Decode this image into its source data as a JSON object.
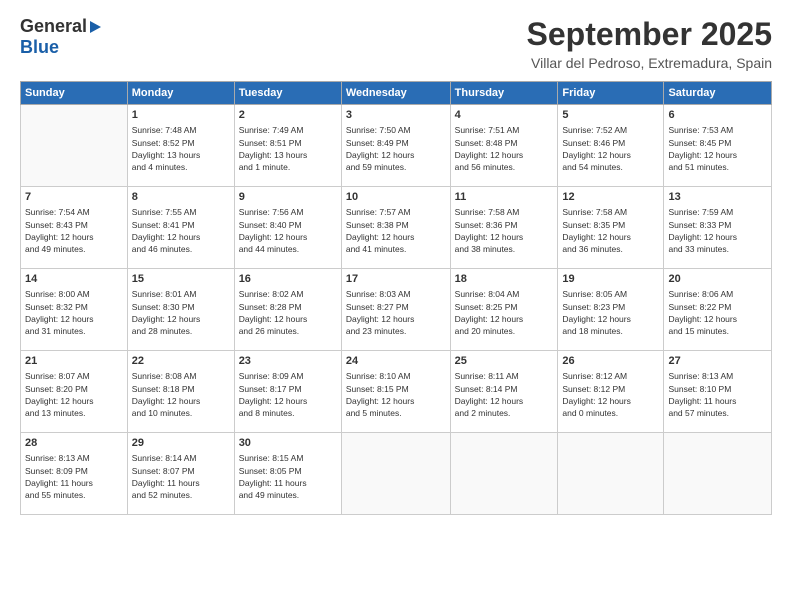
{
  "logo": {
    "line1": "General",
    "arrow": "▶",
    "line2": "Blue"
  },
  "title": "September 2025",
  "location": "Villar del Pedroso, Extremadura, Spain",
  "weekdays": [
    "Sunday",
    "Monday",
    "Tuesday",
    "Wednesday",
    "Thursday",
    "Friday",
    "Saturday"
  ],
  "weeks": [
    [
      {
        "day": "",
        "info": ""
      },
      {
        "day": "1",
        "info": "Sunrise: 7:48 AM\nSunset: 8:52 PM\nDaylight: 13 hours\nand 4 minutes."
      },
      {
        "day": "2",
        "info": "Sunrise: 7:49 AM\nSunset: 8:51 PM\nDaylight: 13 hours\nand 1 minute."
      },
      {
        "day": "3",
        "info": "Sunrise: 7:50 AM\nSunset: 8:49 PM\nDaylight: 12 hours\nand 59 minutes."
      },
      {
        "day": "4",
        "info": "Sunrise: 7:51 AM\nSunset: 8:48 PM\nDaylight: 12 hours\nand 56 minutes."
      },
      {
        "day": "5",
        "info": "Sunrise: 7:52 AM\nSunset: 8:46 PM\nDaylight: 12 hours\nand 54 minutes."
      },
      {
        "day": "6",
        "info": "Sunrise: 7:53 AM\nSunset: 8:45 PM\nDaylight: 12 hours\nand 51 minutes."
      }
    ],
    [
      {
        "day": "7",
        "info": "Sunrise: 7:54 AM\nSunset: 8:43 PM\nDaylight: 12 hours\nand 49 minutes."
      },
      {
        "day": "8",
        "info": "Sunrise: 7:55 AM\nSunset: 8:41 PM\nDaylight: 12 hours\nand 46 minutes."
      },
      {
        "day": "9",
        "info": "Sunrise: 7:56 AM\nSunset: 8:40 PM\nDaylight: 12 hours\nand 44 minutes."
      },
      {
        "day": "10",
        "info": "Sunrise: 7:57 AM\nSunset: 8:38 PM\nDaylight: 12 hours\nand 41 minutes."
      },
      {
        "day": "11",
        "info": "Sunrise: 7:58 AM\nSunset: 8:36 PM\nDaylight: 12 hours\nand 38 minutes."
      },
      {
        "day": "12",
        "info": "Sunrise: 7:58 AM\nSunset: 8:35 PM\nDaylight: 12 hours\nand 36 minutes."
      },
      {
        "day": "13",
        "info": "Sunrise: 7:59 AM\nSunset: 8:33 PM\nDaylight: 12 hours\nand 33 minutes."
      }
    ],
    [
      {
        "day": "14",
        "info": "Sunrise: 8:00 AM\nSunset: 8:32 PM\nDaylight: 12 hours\nand 31 minutes."
      },
      {
        "day": "15",
        "info": "Sunrise: 8:01 AM\nSunset: 8:30 PM\nDaylight: 12 hours\nand 28 minutes."
      },
      {
        "day": "16",
        "info": "Sunrise: 8:02 AM\nSunset: 8:28 PM\nDaylight: 12 hours\nand 26 minutes."
      },
      {
        "day": "17",
        "info": "Sunrise: 8:03 AM\nSunset: 8:27 PM\nDaylight: 12 hours\nand 23 minutes."
      },
      {
        "day": "18",
        "info": "Sunrise: 8:04 AM\nSunset: 8:25 PM\nDaylight: 12 hours\nand 20 minutes."
      },
      {
        "day": "19",
        "info": "Sunrise: 8:05 AM\nSunset: 8:23 PM\nDaylight: 12 hours\nand 18 minutes."
      },
      {
        "day": "20",
        "info": "Sunrise: 8:06 AM\nSunset: 8:22 PM\nDaylight: 12 hours\nand 15 minutes."
      }
    ],
    [
      {
        "day": "21",
        "info": "Sunrise: 8:07 AM\nSunset: 8:20 PM\nDaylight: 12 hours\nand 13 minutes."
      },
      {
        "day": "22",
        "info": "Sunrise: 8:08 AM\nSunset: 8:18 PM\nDaylight: 12 hours\nand 10 minutes."
      },
      {
        "day": "23",
        "info": "Sunrise: 8:09 AM\nSunset: 8:17 PM\nDaylight: 12 hours\nand 8 minutes."
      },
      {
        "day": "24",
        "info": "Sunrise: 8:10 AM\nSunset: 8:15 PM\nDaylight: 12 hours\nand 5 minutes."
      },
      {
        "day": "25",
        "info": "Sunrise: 8:11 AM\nSunset: 8:14 PM\nDaylight: 12 hours\nand 2 minutes."
      },
      {
        "day": "26",
        "info": "Sunrise: 8:12 AM\nSunset: 8:12 PM\nDaylight: 12 hours\nand 0 minutes."
      },
      {
        "day": "27",
        "info": "Sunrise: 8:13 AM\nSunset: 8:10 PM\nDaylight: 11 hours\nand 57 minutes."
      }
    ],
    [
      {
        "day": "28",
        "info": "Sunrise: 8:13 AM\nSunset: 8:09 PM\nDaylight: 11 hours\nand 55 minutes."
      },
      {
        "day": "29",
        "info": "Sunrise: 8:14 AM\nSunset: 8:07 PM\nDaylight: 11 hours\nand 52 minutes."
      },
      {
        "day": "30",
        "info": "Sunrise: 8:15 AM\nSunset: 8:05 PM\nDaylight: 11 hours\nand 49 minutes."
      },
      {
        "day": "",
        "info": ""
      },
      {
        "day": "",
        "info": ""
      },
      {
        "day": "",
        "info": ""
      },
      {
        "day": "",
        "info": ""
      }
    ]
  ]
}
